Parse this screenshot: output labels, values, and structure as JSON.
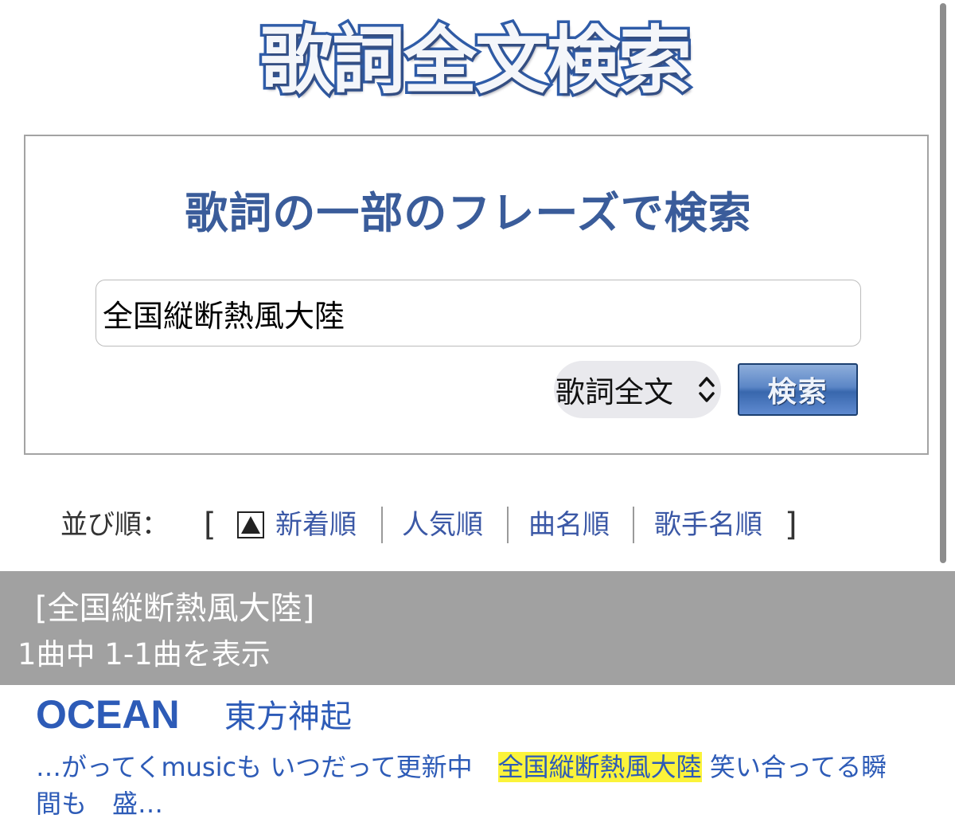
{
  "logo": {
    "text": "歌詞全文検索"
  },
  "search": {
    "heading": "歌詞の一部のフレーズで検索",
    "input_value": "全国縦断熱風大陸",
    "scope_label": "歌詞全文",
    "button_label": "検索"
  },
  "sort": {
    "label": "並び順：",
    "open_bracket": "[",
    "close_bracket": "]",
    "items": [
      "新着順",
      "人気順",
      "曲名順",
      "歌手名順"
    ]
  },
  "results": {
    "query_echo": "[全国縦断熱風大陸]",
    "count_text": "1曲中 1-1曲を表示",
    "items": [
      {
        "title": "OCEAN",
        "artist": "東方神起",
        "snippet_before": "…がってくmusicも いつだって更新中　",
        "snippet_highlight": "全国縦断熱風大陸",
        "snippet_after": " 笑い合ってる瞬間も　盛…"
      }
    ]
  },
  "colors": {
    "link": "#2d5bb7",
    "heading": "#3a5c9a",
    "highlight": "#fbf33a",
    "results_header_bg": "#a1a1a1"
  }
}
